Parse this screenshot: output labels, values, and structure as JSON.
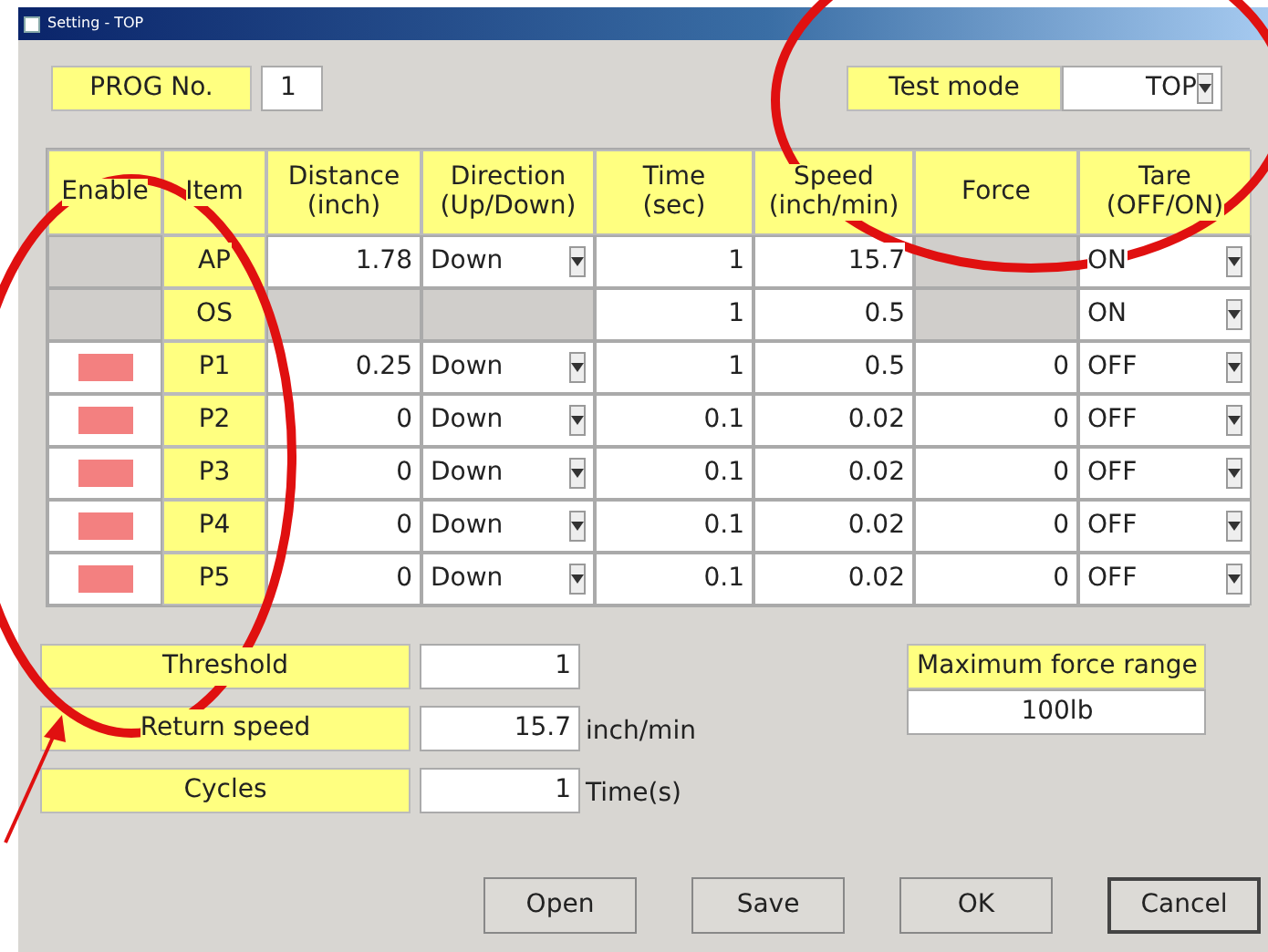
{
  "window": {
    "title": "Setting - TOP"
  },
  "prog_no": {
    "label": "PROG No.",
    "value": "1"
  },
  "test_mode": {
    "label": "Test mode",
    "value": "TOP"
  },
  "table": {
    "columns": [
      "Enable",
      "Item",
      "Distance\n(inch)",
      "Direction\n(Up/Down)",
      "Time\n(sec)",
      "Speed\n(inch/min)",
      "Force",
      "Tare\n(OFF/ON)"
    ],
    "rows": [
      {
        "enabled": false,
        "item": "AP",
        "distance": "1.78",
        "direction": "Down",
        "time": "1",
        "speed": "15.7",
        "tare": "ON"
      },
      {
        "enabled": false,
        "item": "OS",
        "time": "1",
        "speed": "0.5",
        "tare": "ON"
      },
      {
        "enabled": true,
        "item": "P1",
        "distance": "0.25",
        "direction": "Down",
        "time": "1",
        "speed": "0.5",
        "force": "0",
        "tare": "OFF"
      },
      {
        "enabled": true,
        "item": "P2",
        "distance": "0",
        "direction": "Down",
        "time": "0.1",
        "speed": "0.02",
        "force": "0",
        "tare": "OFF"
      },
      {
        "enabled": true,
        "item": "P3",
        "distance": "0",
        "direction": "Down",
        "time": "0.1",
        "speed": "0.02",
        "force": "0",
        "tare": "OFF"
      },
      {
        "enabled": true,
        "item": "P4",
        "distance": "0",
        "direction": "Down",
        "time": "0.1",
        "speed": "0.02",
        "force": "0",
        "tare": "OFF"
      },
      {
        "enabled": true,
        "item": "P5",
        "distance": "0",
        "direction": "Down",
        "time": "0.1",
        "speed": "0.02",
        "force": "0",
        "tare": "OFF"
      }
    ]
  },
  "settings": [
    {
      "label": "Threshold",
      "value": "1"
    },
    {
      "label": "Return speed",
      "value": "15.7",
      "unit": "inch/min"
    },
    {
      "label": "Cycles",
      "value": "1",
      "unit": "Time(s)"
    }
  ],
  "max_force_range": {
    "label": "Maximum force range",
    "value": "100lb"
  },
  "buttons": [
    {
      "label": "Open",
      "default": false
    },
    {
      "label": "Save",
      "default": false
    },
    {
      "label": "OK",
      "default": false
    },
    {
      "label": "Cancel",
      "default": true
    }
  ],
  "annotations": [
    {
      "kind": "ellipse"
    },
    {
      "kind": "ellipse"
    },
    {
      "kind": "arrow"
    }
  ]
}
